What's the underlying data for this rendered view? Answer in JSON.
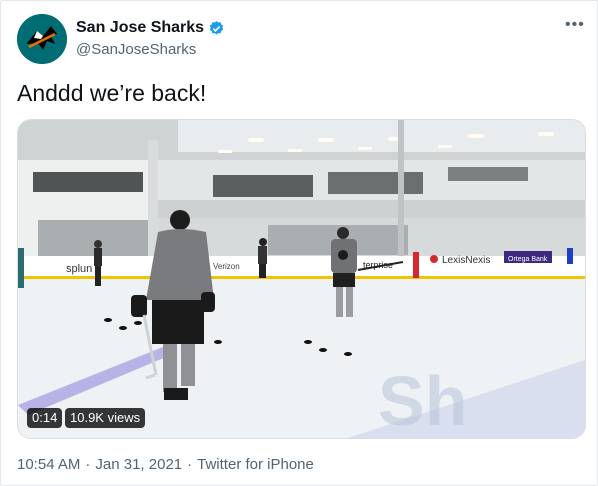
{
  "account": {
    "display_name": "San Jose Sharks",
    "handle": "@SanJoseSharks",
    "avatar_icon": "sharks-logo-icon",
    "verified_icon": "verified-badge-icon",
    "more_icon": "more-options-icon",
    "brand_color": "#006d75",
    "verified_color": "#1d9bf0"
  },
  "tweet": {
    "text": "Anddd we’re back!"
  },
  "video": {
    "duration": "0:14",
    "views": "10.9K views",
    "rink_signs": [
      "splun",
      "Verizon",
      "LexisNexis",
      "Ortega Bank",
      "terprise"
    ]
  },
  "meta": {
    "time": "10:54 AM",
    "separator": "·",
    "date": "Jan 31, 2021",
    "source": "Twitter for iPhone"
  }
}
